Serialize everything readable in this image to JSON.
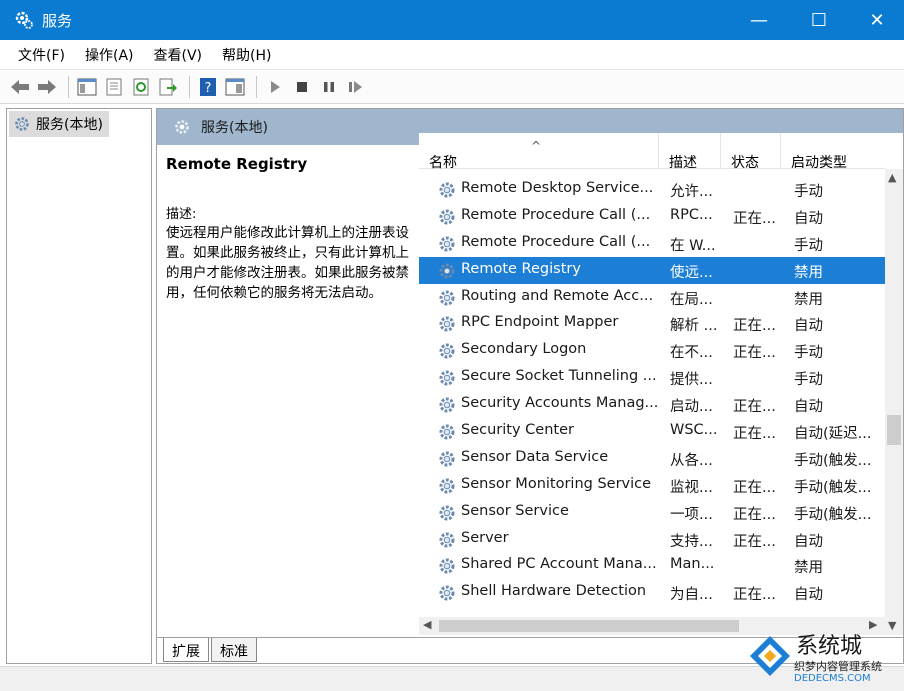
{
  "window": {
    "title": "服务",
    "minimize_label": "—",
    "maximize_label": "☐",
    "close_label": "✕"
  },
  "menu": {
    "items": [
      "文件(F)",
      "操作(A)",
      "查看(V)",
      "帮助(H)"
    ]
  },
  "toolbar": {
    "icons": [
      "back-icon",
      "forward-icon",
      "show-hide-tree-icon",
      "properties-icon",
      "refresh-icon",
      "export-icon",
      "help-icon",
      "console-icon",
      "play-icon",
      "stop-icon",
      "pause-icon",
      "restart-icon"
    ]
  },
  "tree": {
    "root_label": "服务(本地)"
  },
  "content": {
    "header": "服务(本地)",
    "selected_service": "Remote Registry",
    "description_label": "描述:",
    "description_text": "使远程用户能修改此计算机上的注册表设置。如果此服务被终止，只有此计算机上的用户才能修改注册表。如果此服务被禁用，任何依赖它的服务将无法启动。"
  },
  "list": {
    "columns": [
      "名称",
      "描述",
      "状态",
      "启动类型"
    ],
    "rows": [
      {
        "name": "Remote Desktop Service...",
        "desc": "允许...",
        "status": "",
        "startup": "手动"
      },
      {
        "name": "Remote Procedure Call (...",
        "desc": "RPC...",
        "status": "正在...",
        "startup": "自动"
      },
      {
        "name": "Remote Procedure Call (...",
        "desc": "在 W...",
        "status": "",
        "startup": "手动"
      },
      {
        "name": "Remote Registry",
        "desc": "使远...",
        "status": "",
        "startup": "禁用"
      },
      {
        "name": "Routing and Remote Acc...",
        "desc": "在局...",
        "status": "",
        "startup": "禁用"
      },
      {
        "name": "RPC Endpoint Mapper",
        "desc": "解析 ...",
        "status": "正在...",
        "startup": "自动"
      },
      {
        "name": "Secondary Logon",
        "desc": "在不...",
        "status": "正在...",
        "startup": "手动"
      },
      {
        "name": "Secure Socket Tunneling ...",
        "desc": "提供...",
        "status": "",
        "startup": "手动"
      },
      {
        "name": "Security Accounts Manag...",
        "desc": "启动...",
        "status": "正在...",
        "startup": "自动"
      },
      {
        "name": "Security Center",
        "desc": "WSC...",
        "status": "正在...",
        "startup": "自动(延迟..."
      },
      {
        "name": "Sensor Data Service",
        "desc": "从各...",
        "status": "",
        "startup": "手动(触发..."
      },
      {
        "name": "Sensor Monitoring Service",
        "desc": "监视...",
        "status": "正在...",
        "startup": "手动(触发..."
      },
      {
        "name": "Sensor Service",
        "desc": "一项...",
        "status": "正在...",
        "startup": "手动(触发..."
      },
      {
        "name": "Server",
        "desc": "支持...",
        "status": "正在...",
        "startup": "自动"
      },
      {
        "name": "Shared PC Account Mana...",
        "desc": "Man...",
        "status": "",
        "startup": "禁用"
      },
      {
        "name": "Shell Hardware Detection",
        "desc": "为自...",
        "status": "正在...",
        "startup": "自动"
      }
    ],
    "selected_index": 3
  },
  "tabs": [
    "扩展",
    "标准"
  ],
  "watermark": {
    "line1": "系统城",
    "line2": "织梦内容管理系统",
    "line3": "DEDECMS.COM"
  },
  "colors": {
    "titlebar": "#0a7bd0",
    "selection": "#1c7fd5",
    "content_header": "#9fb6cc"
  }
}
